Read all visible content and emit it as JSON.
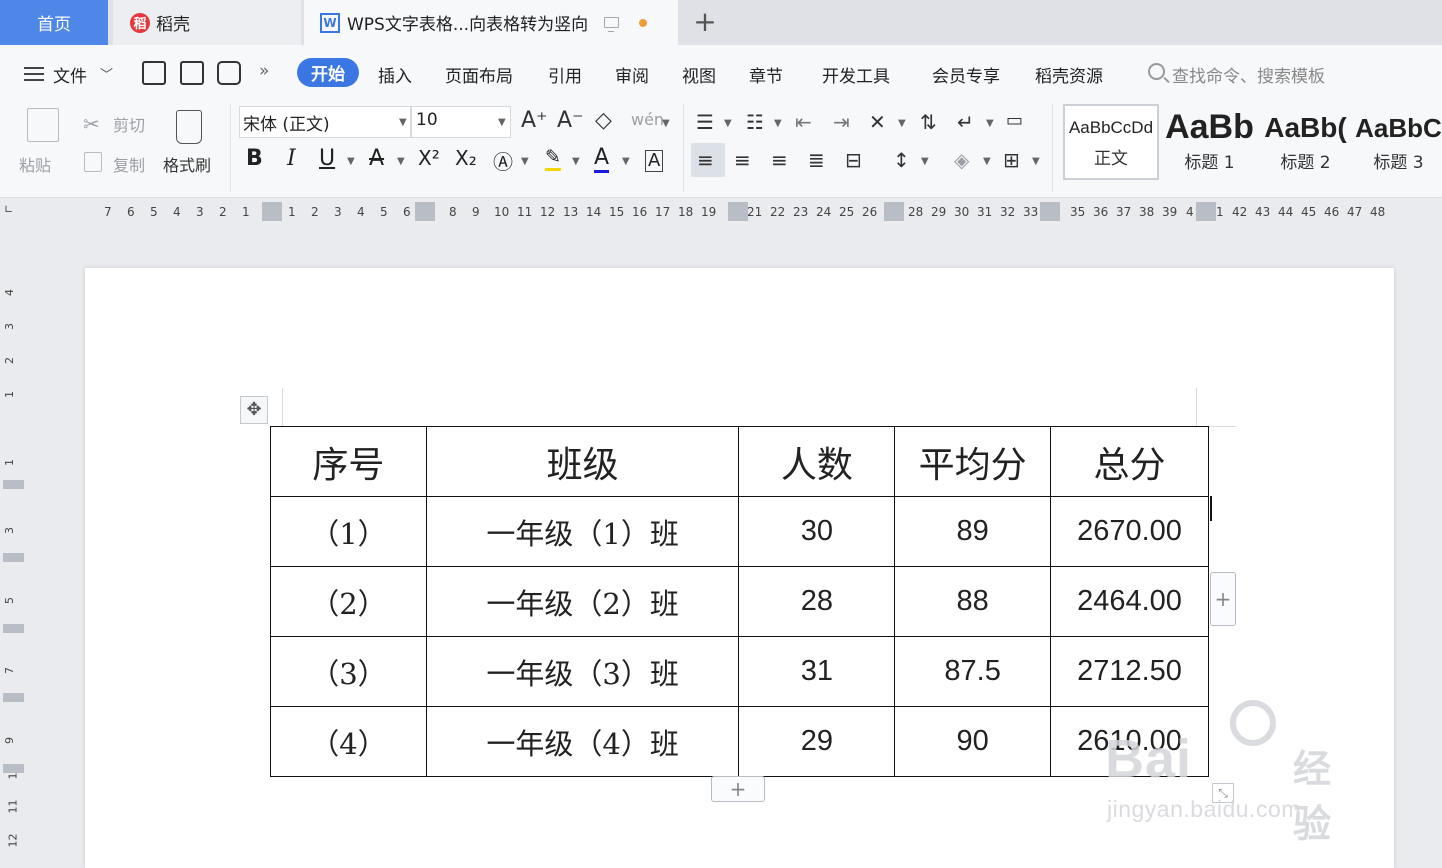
{
  "tabs": {
    "home": "首页",
    "daoke": "稻壳",
    "document": "WPS文字表格...向表格转为竖向",
    "add": "+"
  },
  "menu": {
    "file": "文件",
    "ribbon_tabs": [
      "开始",
      "插入",
      "页面布局",
      "引用",
      "审阅",
      "视图",
      "章节",
      "开发工具",
      "会员专享",
      "稻壳资源"
    ],
    "active_tab": "开始",
    "search_placeholder": "查找命令、搜索模板"
  },
  "toolbar": {
    "paste": "粘贴",
    "cut": "剪切",
    "copy": "复制",
    "format_painter": "格式刷",
    "font_name": "宋体 (正文)",
    "font_size": "10",
    "bold": "B",
    "italic": "I",
    "underline": "U",
    "strike": "A",
    "superscript": "X²",
    "subscript": "X₂",
    "font_color": "A",
    "char_border": "A",
    "grow_font": "A⁺",
    "shrink_font": "A⁻",
    "pinyin": "wén"
  },
  "styles": [
    {
      "sample": "AaBbCcDd",
      "name": "正文"
    },
    {
      "sample": "AaBb",
      "name": "标题 1"
    },
    {
      "sample": "AaBb(",
      "name": "标题 2"
    },
    {
      "sample": "AaBbC",
      "name": "标题 3"
    }
  ],
  "ruler": {
    "horizontal": [
      "7",
      "6",
      "5",
      "4",
      "3",
      "2",
      "1",
      "1",
      "2",
      "3",
      "4",
      "5",
      "6",
      "8",
      "9",
      "10",
      "11",
      "12",
      "13",
      "14",
      "15",
      "16",
      "17",
      "18",
      "19",
      "21",
      "22",
      "23",
      "24",
      "25",
      "26",
      "28",
      "29",
      "30",
      "31",
      "32",
      "33",
      "35",
      "36",
      "37",
      "38",
      "39",
      "4",
      "1",
      "42",
      "43",
      "44",
      "45",
      "46",
      "47",
      "48"
    ],
    "vertical": [
      "4",
      "3",
      "2",
      "1",
      "1",
      "3",
      "5",
      "7",
      "9",
      "10",
      "11",
      "12"
    ]
  },
  "table": {
    "headers": [
      "序号",
      "班级",
      "人数",
      "平均分",
      "总分"
    ],
    "rows": [
      [
        "（1）",
        "一年级（1）班",
        "30",
        "89",
        "2670.00"
      ],
      [
        "（2）",
        "一年级（2）班",
        "28",
        "88",
        "2464.00"
      ],
      [
        "（3）",
        "一年级（3）班",
        "31",
        "87.5",
        "2712.50"
      ],
      [
        "（4）",
        "一年级（4）班",
        "29",
        "90",
        "2610.00"
      ]
    ]
  },
  "table_controls": {
    "move": "✥",
    "add_column": "+",
    "add_row": "+"
  },
  "watermark": {
    "brand": "Bai",
    "suffix": "经验",
    "url": "jingyan.baidu.com"
  }
}
